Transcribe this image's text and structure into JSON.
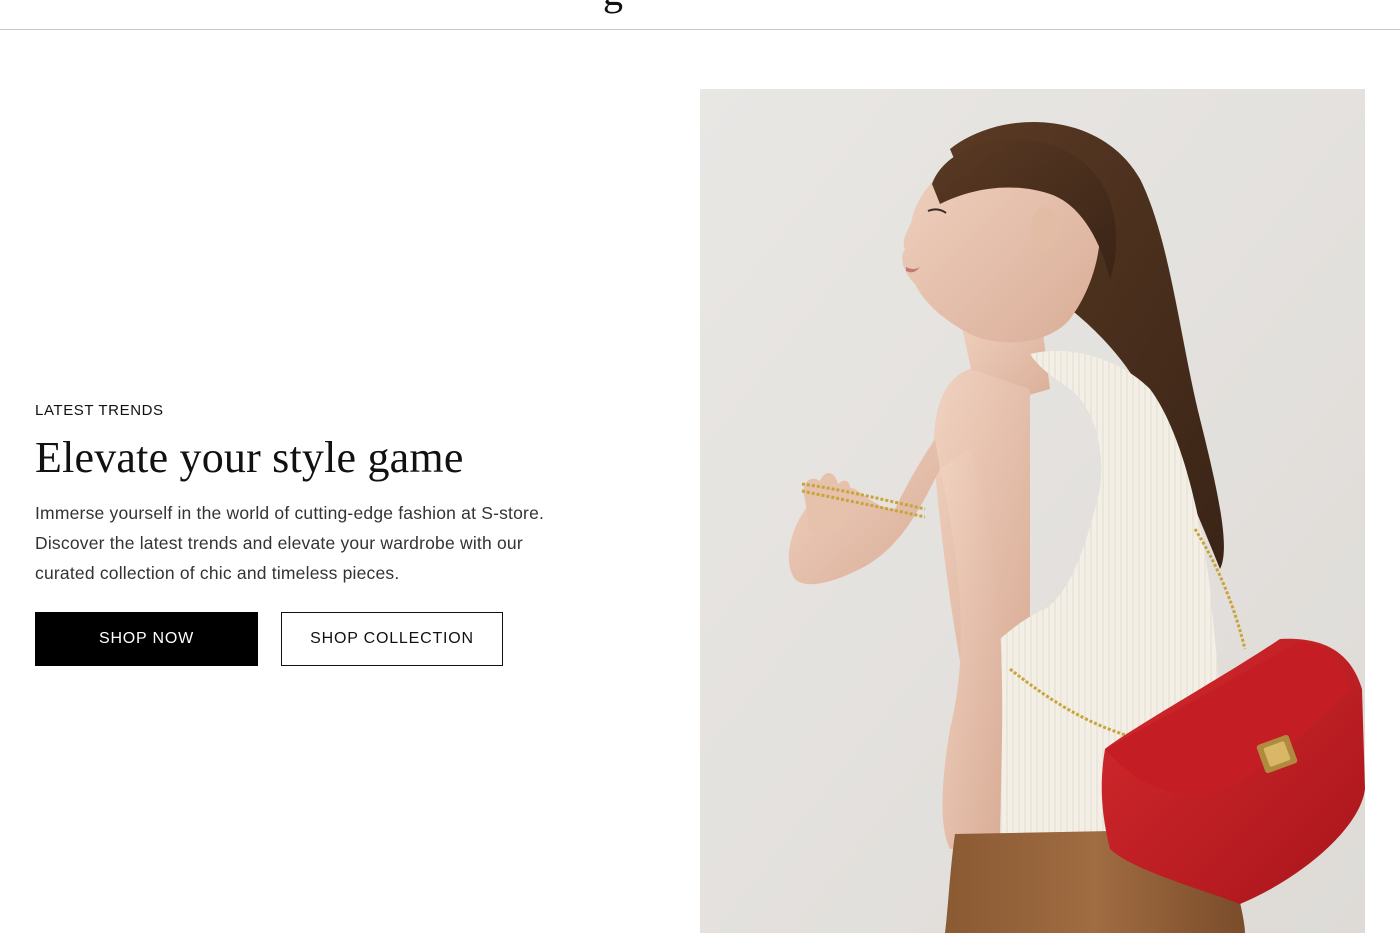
{
  "header": {
    "logo_fragment": "g"
  },
  "hero": {
    "eyebrow": "LATEST TRENDS",
    "headline": "Elevate your style game",
    "description": "Immerse yourself in the world of cutting-edge fashion at S-store. Discover the latest trends and elevate your wardrobe with our curated collection of chic and timeless pieces.",
    "primary_button": "SHOP NOW",
    "secondary_button": "SHOP COLLECTION"
  },
  "colors": {
    "primary_button_bg": "#000000",
    "primary_button_text": "#ffffff",
    "image_background": "#e8e6e3",
    "bag_red": "#c81e24"
  },
  "image": {
    "subject": "model-with-red-chain-shoulder-bag"
  }
}
